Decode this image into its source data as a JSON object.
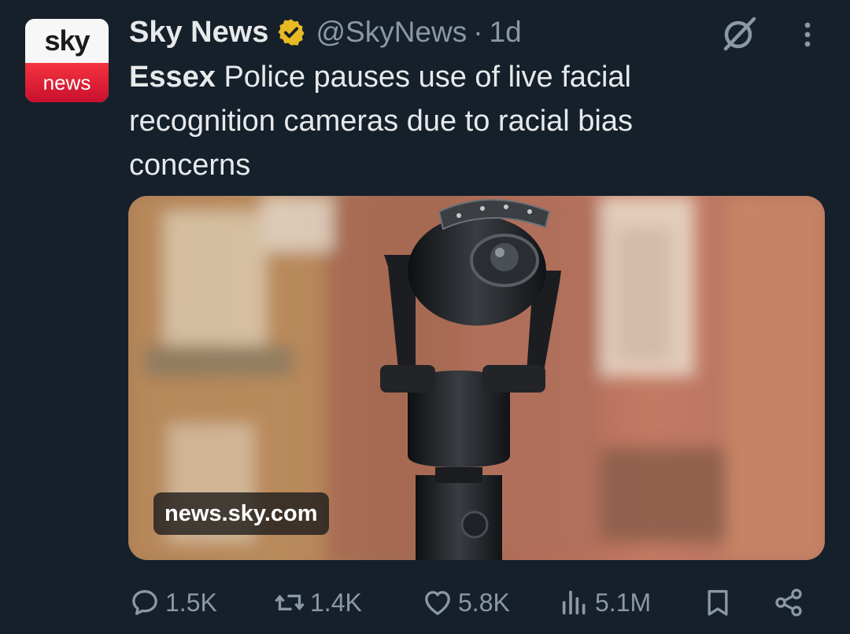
{
  "account": {
    "name": "Sky News",
    "handle": "@SkyNews",
    "separator": "·",
    "time": "1d",
    "avatar_top": "sky",
    "avatar_bottom": "news"
  },
  "tweet": {
    "text_bold": "Essex",
    "text_rest": " Police pauses use of live facial recognition cameras due to racial bias concerns"
  },
  "card": {
    "domain": "news.sky.com"
  },
  "actions": {
    "replies": "1.5K",
    "reposts": "1.4K",
    "likes": "5.8K",
    "views": "5.1M"
  },
  "icons": {
    "verified": "verified-badge-icon",
    "grok": "grok-icon",
    "more": "more-icon",
    "reply": "reply-icon",
    "repost": "repost-icon",
    "like": "heart-icon",
    "views": "views-icon",
    "bookmark": "bookmark-icon",
    "share": "share-icon"
  },
  "colors": {
    "background": "#15202b",
    "text": "#e7e9ea",
    "secondary": "#8b98a5",
    "verified": "#e8b923",
    "brand_red": "#d71920"
  }
}
